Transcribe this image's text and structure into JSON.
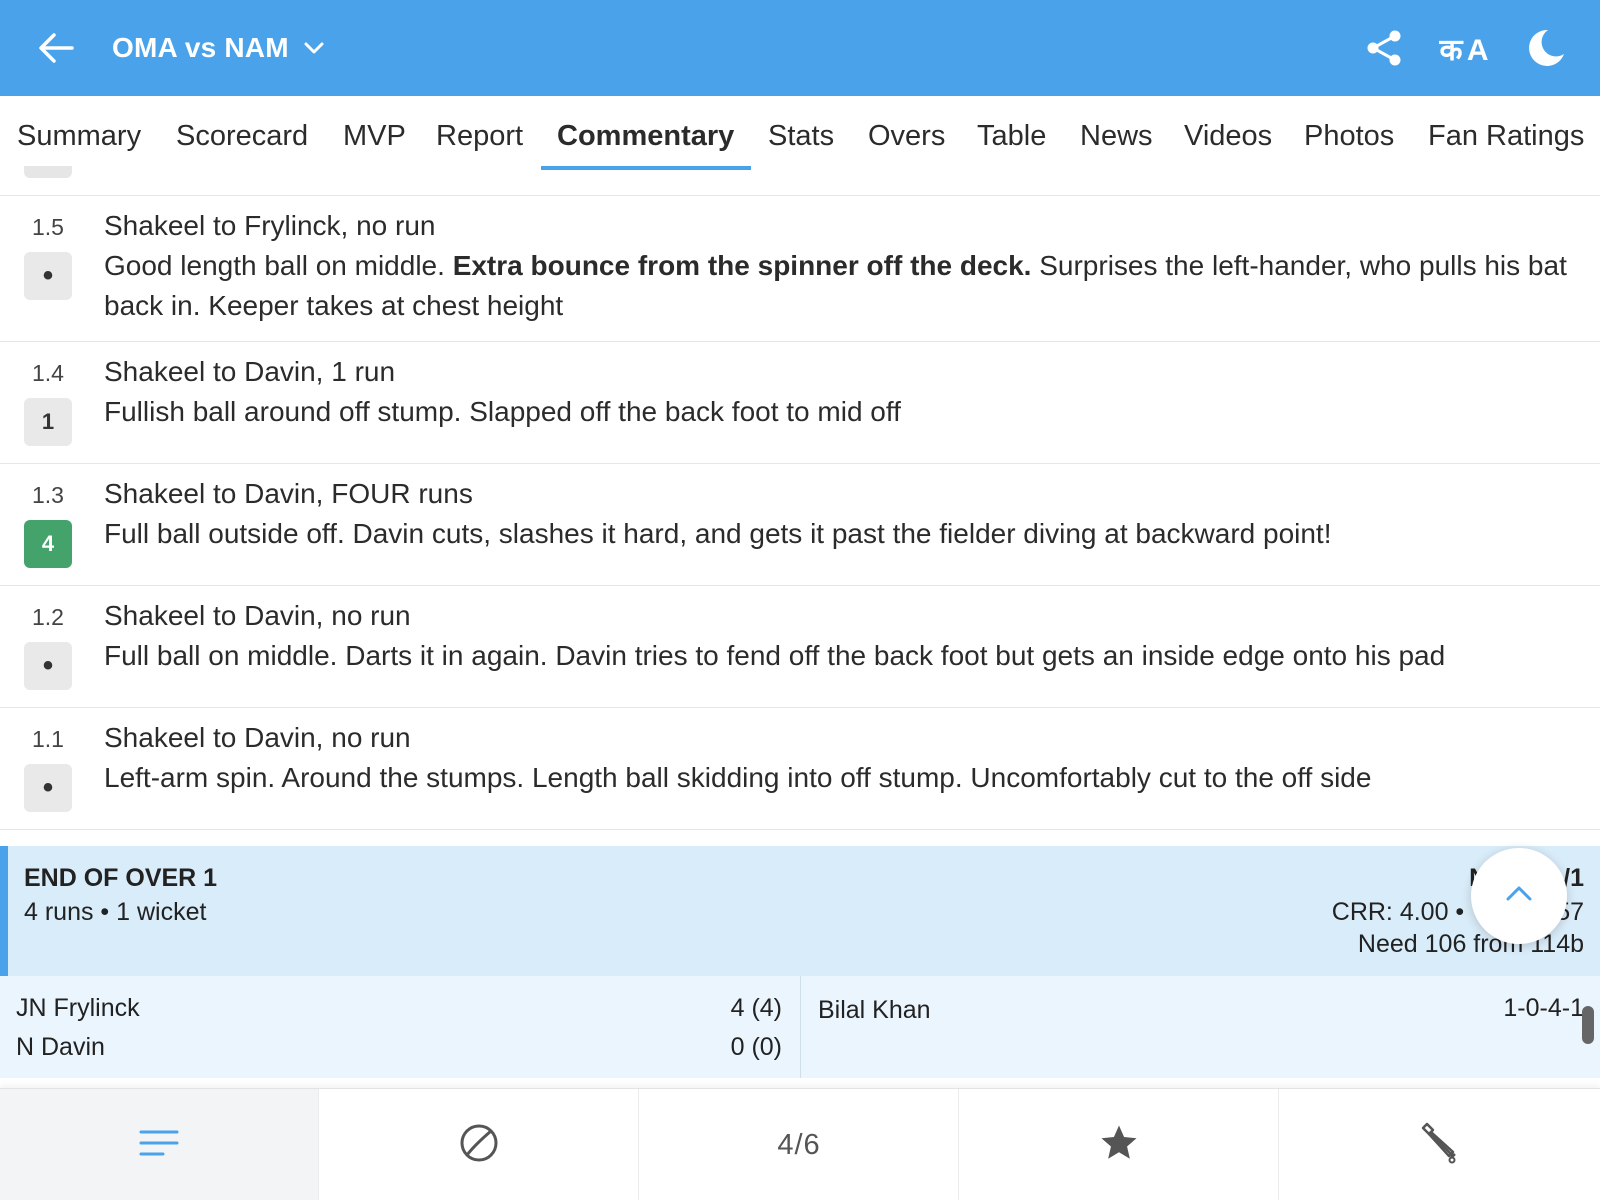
{
  "header": {
    "title": "OMA vs NAM",
    "lang_label": "क A",
    "bg_color": "#4aa3ea"
  },
  "tabs": [
    {
      "label": "Summary",
      "active": false
    },
    {
      "label": "Scorecard",
      "active": false
    },
    {
      "label": "MVP",
      "active": false
    },
    {
      "label": "Report",
      "active": false
    },
    {
      "label": "Commentary",
      "active": true
    },
    {
      "label": "Stats",
      "active": false
    },
    {
      "label": "Overs",
      "active": false
    },
    {
      "label": "Table",
      "active": false
    },
    {
      "label": "News",
      "active": false
    },
    {
      "label": "Videos",
      "active": false
    },
    {
      "label": "Photos",
      "active": false
    },
    {
      "label": "Fan Ratings",
      "active": false
    }
  ],
  "commentary": [
    {
      "over": "1.5",
      "badge": "•",
      "headline": "Shakeel to Frylinck, no run",
      "text_before": "Good length ball on middle. ",
      "text_bold": "Extra bounce from the spinner off the deck.",
      "text_after": " Surprises the left-hander, who pulls his bat back in. Keeper takes at chest height"
    },
    {
      "over": "1.4",
      "badge": "1",
      "headline": "Shakeel to Davin, 1 run",
      "text": "Fullish ball around off stump. Slapped off the back foot to mid off"
    },
    {
      "over": "1.3",
      "badge": "4",
      "headline": "Shakeel to Davin, FOUR runs",
      "text": "Full ball outside off. Davin cuts, slashes it hard, and gets it past the fielder diving at backward point!"
    },
    {
      "over": "1.2",
      "badge": "•",
      "headline": "Shakeel to Davin, no run",
      "text": "Full ball on middle. Darts it in again. Davin tries to fend off the back foot but gets an inside edge onto his pad"
    },
    {
      "over": "1.1",
      "badge": "•",
      "headline": "Shakeel to Davin, no run",
      "text": "Left-arm spin. Around the stumps. Length ball skidding into off stump. Uncomfortably cut to the off side"
    }
  ],
  "end_of_over": {
    "title": "END OF OVER 1",
    "summary": "4 runs • 1 wicket",
    "score": "N",
    "score_tail": "/1",
    "crr": "CRR: 4.00 •",
    "rrr_tail": "57",
    "need": "Need 106 from 114b",
    "batters": [
      {
        "name": "JN Frylinck",
        "figures": "4 (4)"
      },
      {
        "name": "N Davin",
        "figures": "0 (0)"
      }
    ],
    "bowler": {
      "name": "Bilal Khan",
      "figures": "1-0-4-1"
    }
  },
  "bottom_nav": {
    "count": "4/6",
    "accent": "#4aa3ea"
  }
}
